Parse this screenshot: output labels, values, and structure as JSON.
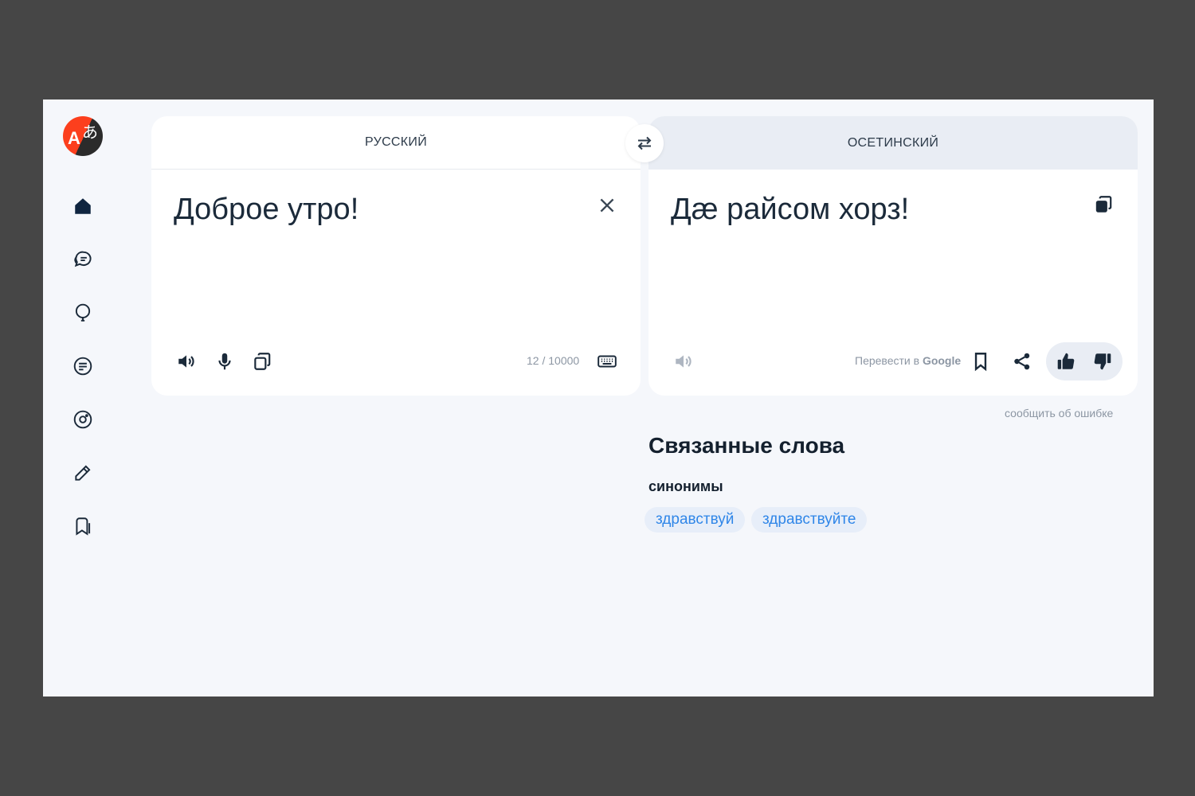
{
  "sidebar": {
    "logo_glyph_latin": "A",
    "logo_glyph_cjk": "あ",
    "items": [
      {
        "icon": "home-icon"
      },
      {
        "icon": "chat-bubbles-icon"
      },
      {
        "icon": "lightbulb-icon"
      },
      {
        "icon": "document-text-icon"
      },
      {
        "icon": "camera-icon"
      },
      {
        "icon": "pencil-icon"
      },
      {
        "icon": "bookmarks-icon"
      }
    ]
  },
  "source": {
    "language": "РУССКИЙ",
    "text": "Доброе утро!",
    "counter": "12 / 10000"
  },
  "target": {
    "language": "ОСЕТИНСКИЙ",
    "text": "Дæ райсом хорз!",
    "google_prefix": "Перевести в",
    "google_brand": "Google"
  },
  "report_error": "сообщить об ошибке",
  "related": {
    "title": "Связанные слова",
    "synonyms_label": "синонимы",
    "synonyms": [
      "здравствуй",
      "здравствуйте"
    ]
  },
  "colors": {
    "accent_link": "#2f86e8",
    "brand_red": "#fc3f1d",
    "icon_dark": "#1b2a3a",
    "icon_muted": "#aeb6c1"
  }
}
